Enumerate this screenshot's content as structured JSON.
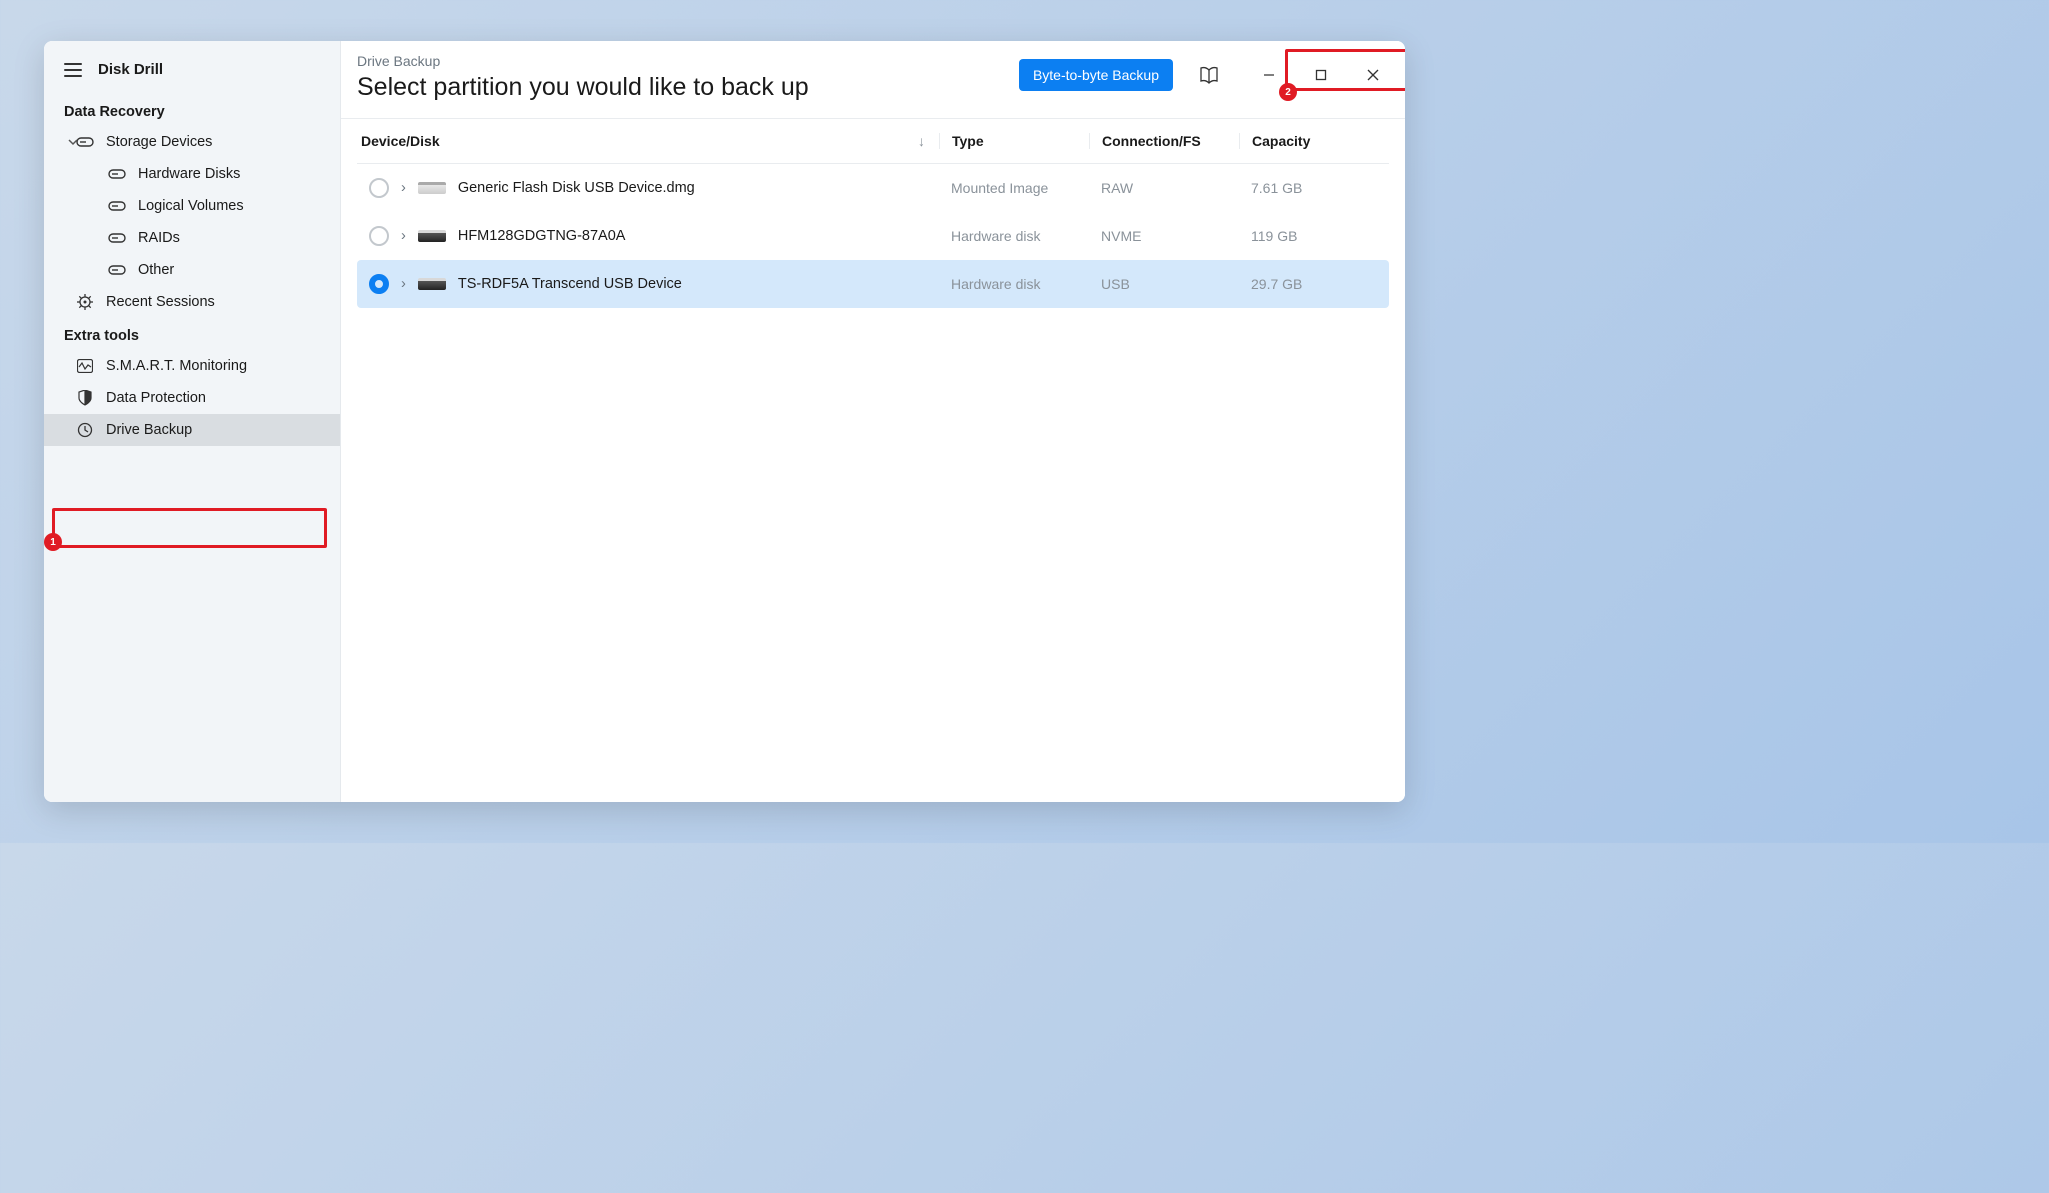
{
  "app": {
    "title": "Disk Drill"
  },
  "sidebar": {
    "section1": "Data Recovery",
    "storage_devices": "Storage Devices",
    "hardware_disks": "Hardware Disks",
    "logical_volumes": "Logical Volumes",
    "raids": "RAIDs",
    "other": "Other",
    "recent_sessions": "Recent Sessions",
    "section2": "Extra tools",
    "smart": "S.M.A.R.T. Monitoring",
    "data_protection": "Data Protection",
    "drive_backup": "Drive Backup"
  },
  "header": {
    "breadcrumb": "Drive Backup",
    "title": "Select partition you would like to back up",
    "primary_button": "Byte-to-byte Backup"
  },
  "table": {
    "col_device": "Device/Disk",
    "col_type": "Type",
    "col_conn": "Connection/FS",
    "col_cap": "Capacity",
    "rows": [
      {
        "name": "Generic Flash Disk USB Device.dmg",
        "type": "Mounted Image",
        "conn": "RAW",
        "cap": "7.61 GB",
        "selected": false
      },
      {
        "name": "HFM128GDGTNG-87A0A",
        "type": "Hardware disk",
        "conn": "NVME",
        "cap": "119 GB",
        "selected": false
      },
      {
        "name": "TS-RDF5A Transcend USB Device",
        "type": "Hardware disk",
        "conn": "USB",
        "cap": "29.7 GB",
        "selected": true
      }
    ]
  },
  "annotations": {
    "badge1": "1",
    "badge2": "2"
  }
}
